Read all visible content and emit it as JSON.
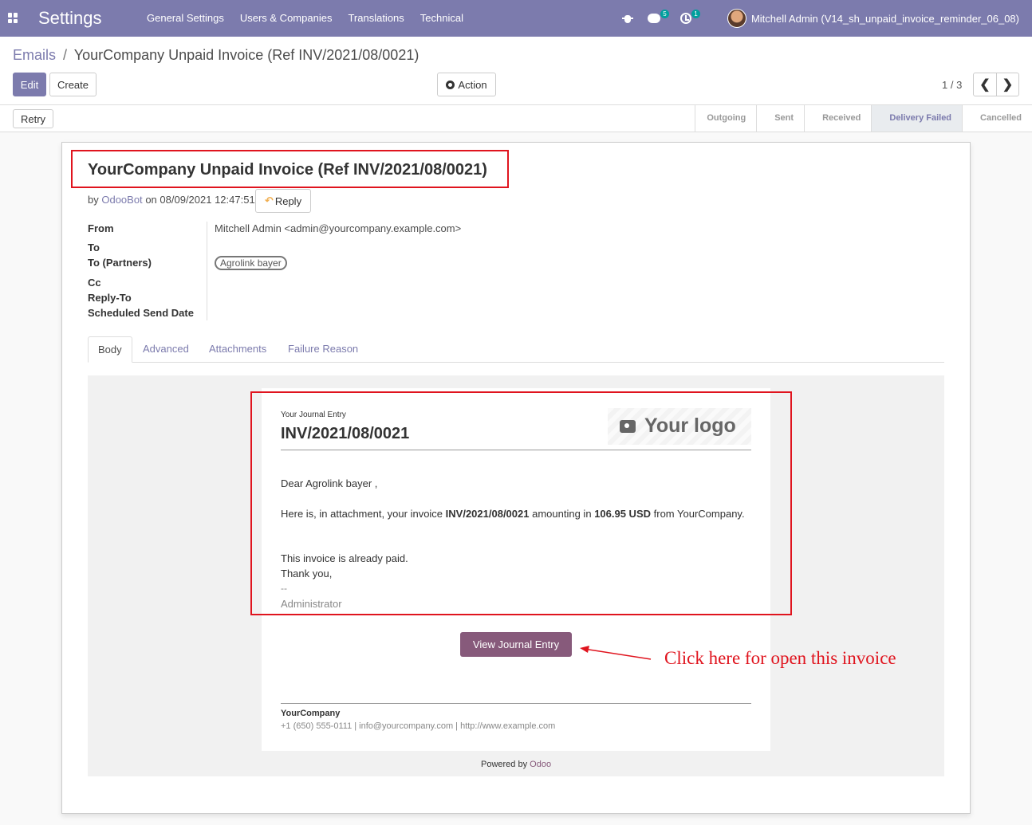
{
  "navbar": {
    "app_title": "Settings",
    "menu": [
      "General Settings",
      "Users & Companies",
      "Translations",
      "Technical"
    ],
    "chat_count": "5",
    "activity_count": "1",
    "user": "Mitchell Admin (V14_sh_unpaid_invoice_reminder_06_08)",
    "color": "#7c7bad"
  },
  "breadcrumb": {
    "parent": "Emails",
    "separator": "/",
    "current": "YourCompany Unpaid Invoice (Ref INV/2021/08/0021)"
  },
  "controls": {
    "edit": "Edit",
    "create": "Create",
    "action": "Action",
    "pager": "1 / 3",
    "prev": "❮",
    "next": "❯"
  },
  "status": {
    "retry": "Retry",
    "stages": [
      "Outgoing",
      "Sent",
      "Received",
      "Delivery Failed",
      "Cancelled"
    ],
    "active_stage": "Delivery Failed"
  },
  "mail": {
    "subject": "YourCompany Unpaid Invoice (Ref INV/2021/08/0021)",
    "by": "by",
    "author": "OdooBot",
    "on": "on",
    "date": "08/09/2021 12:47:51",
    "reply": "Reply",
    "fields": {
      "from_label": "From",
      "from_value": "Mitchell Admin <admin@yourcompany.example.com>",
      "to_label": "To",
      "to_partners_label": "To (Partners)",
      "partner_tag": "Agrolink bayer",
      "cc_label": "Cc",
      "reply_to_label": "Reply-To",
      "scheduled_label": "Scheduled Send Date"
    },
    "tabs": [
      "Body",
      "Advanced",
      "Attachments",
      "Failure Reason"
    ],
    "active_tab": "Body"
  },
  "body": {
    "journal_small": "Your Journal Entry",
    "journal_number": "INV/2021/08/0021",
    "logo_text": "Your logo",
    "greeting": "Dear Agrolink bayer ,",
    "line_prefix": "Here is, in attachment, your invoice",
    "invoice": "INV/2021/08/0021",
    "line_mid": "amounting in",
    "amount": "106.95 USD",
    "line_suffix": "from YourCompany.",
    "paid_note": "This invoice is already paid.",
    "thanks": "Thank you,",
    "sig_dash": "--",
    "sig_name": "Administrator",
    "view_button": "View Journal Entry",
    "company_name": "YourCompany",
    "company_contact": "+1 (650) 555-0111 | info@yourcompany.com | http://www.example.com",
    "powered_by": "Powered by",
    "powered_odoo": "Odoo",
    "button_color": "#875a7b"
  },
  "annotation": {
    "text": "Click here for open this invoice",
    "color": "#e0141e"
  }
}
